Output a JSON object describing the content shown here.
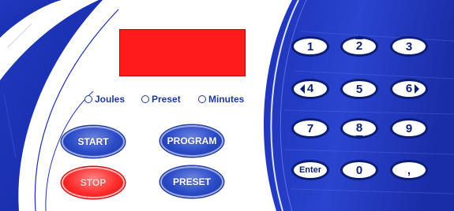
{
  "display": {
    "text": ""
  },
  "mode_options": [
    {
      "id": "joules",
      "label": "Joules"
    },
    {
      "id": "preset",
      "label": "Preset"
    },
    {
      "id": "minutes",
      "label": "Minutes"
    }
  ],
  "controls": {
    "start": "START",
    "program": "PROGRAM",
    "stop": "STOP",
    "preset": "PRESET"
  },
  "keypad": {
    "k1": "1",
    "k2": "2",
    "k3": "3",
    "k4": "4",
    "k5": "5",
    "k6": "6",
    "k7": "7",
    "k8": "8",
    "k9": "9",
    "enter": "Enter",
    "k0": "0",
    "comma": ","
  },
  "colors": {
    "panel_blue": "#1a2fb4",
    "display_red": "#ff1b1b",
    "button_blue": "#2b4cc8",
    "button_red": "#ff2e2e",
    "key_outline": "#0d1e72"
  }
}
